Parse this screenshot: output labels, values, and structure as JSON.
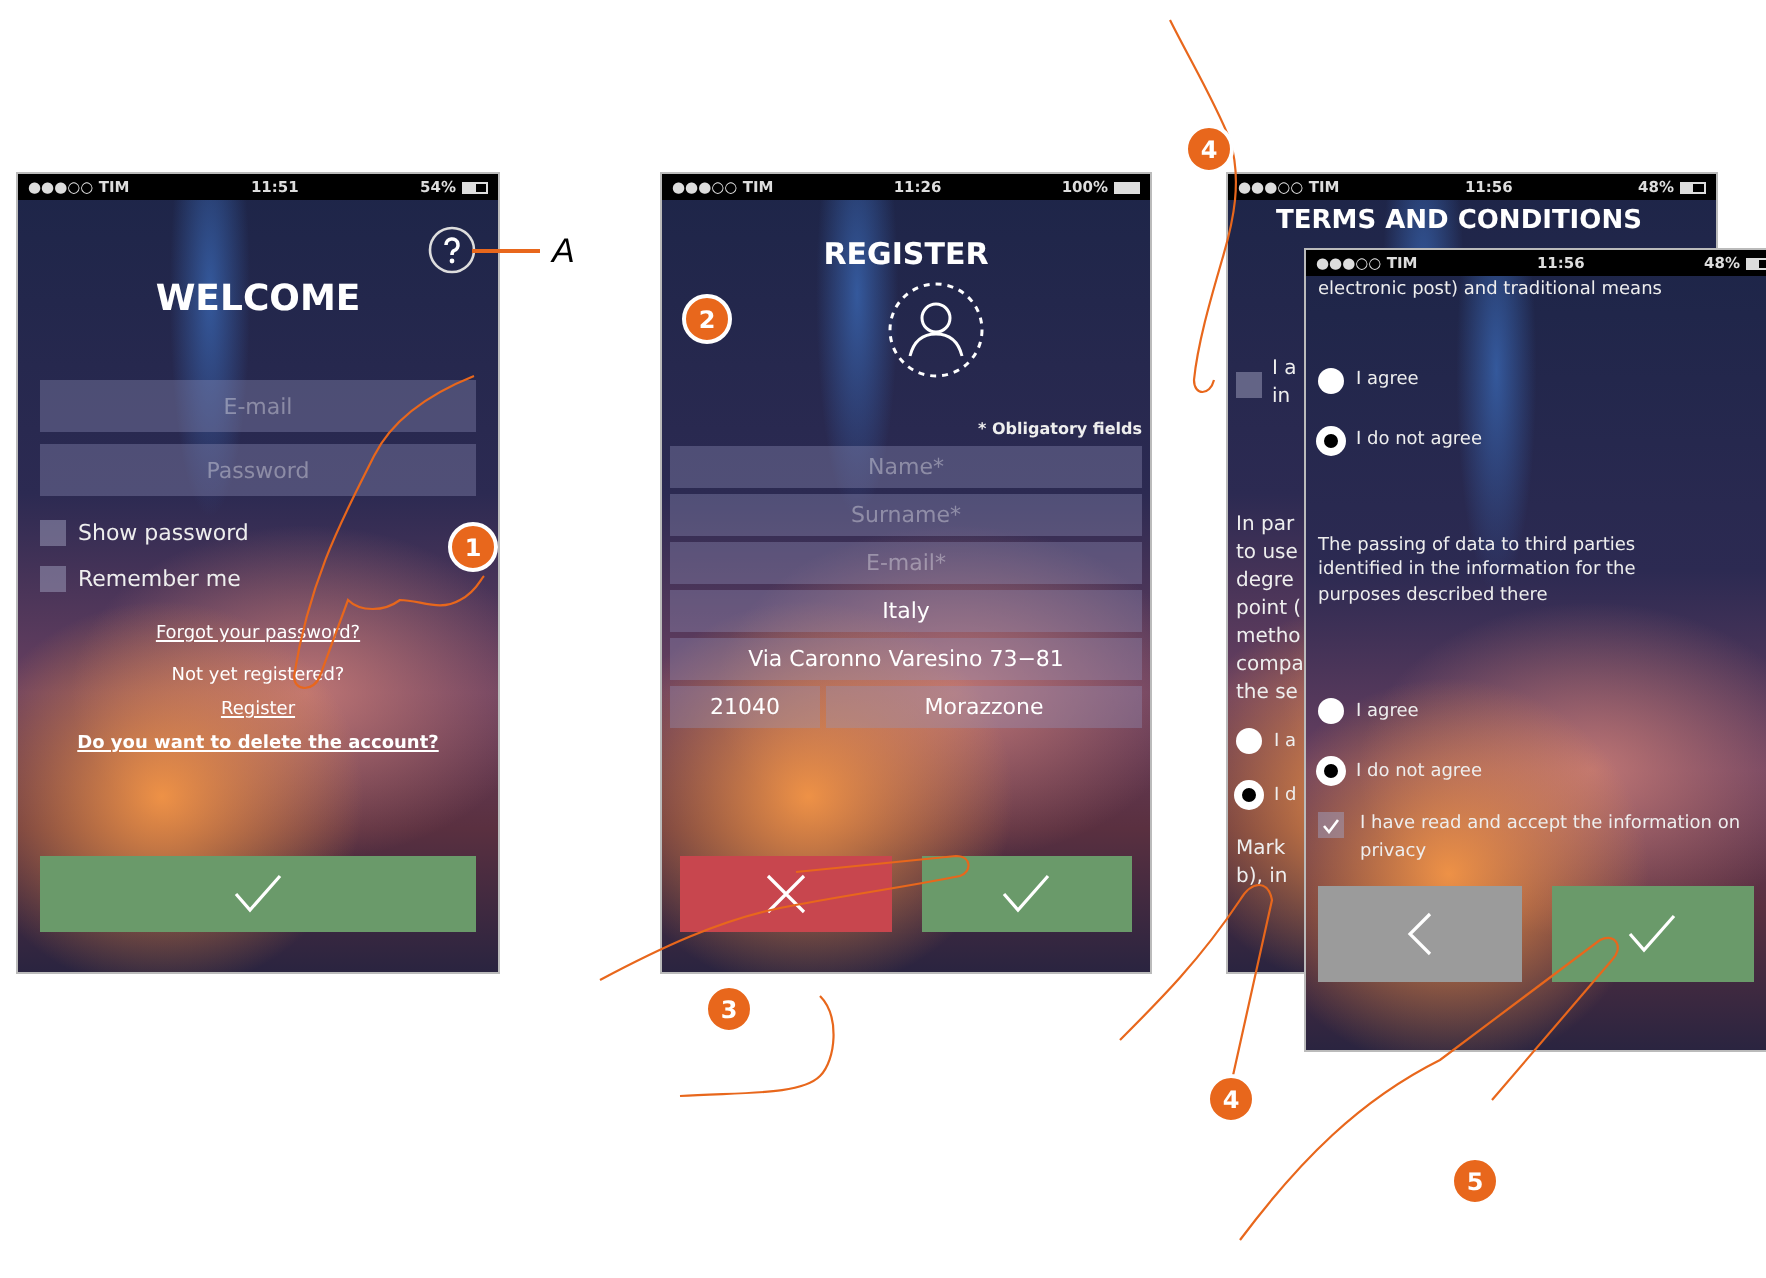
{
  "login": {
    "status": {
      "signal": "●●●○○ TIM",
      "time": "11:51",
      "battery": "54%"
    },
    "title": "WELCOME",
    "fields": [
      {
        "placeholder": "E-mail"
      },
      {
        "placeholder": "Password"
      }
    ],
    "checkboxes": [
      {
        "label": "Show password",
        "checked": false
      },
      {
        "label": "Remember me",
        "checked": false
      }
    ],
    "forgot_link": "Forgot your password?",
    "not_registered": "Not yet registered?",
    "register_link": "Register",
    "delete_link": "Do you want to delete the account?"
  },
  "register": {
    "status": {
      "signal": "●●●○○ TIM",
      "time": "11:26",
      "battery": "100%"
    },
    "title": "REGISTER",
    "note": "* Obligatory fields",
    "fields": [
      {
        "placeholder": "Name*"
      },
      {
        "placeholder": "Surname*"
      },
      {
        "placeholder": "E-mail*"
      },
      {
        "value": "Italy"
      },
      {
        "value": "Via Caronno Varesino 73−81"
      }
    ],
    "postcode": "21040",
    "city": "Morazzone"
  },
  "terms_back": {
    "status": {
      "signal": "●●●○○ TIM",
      "time": "11:56",
      "battery": "48%"
    },
    "title": "TERMS AND CONDITIONS",
    "check_lines": [
      "I a",
      "in"
    ],
    "checked": false,
    "paragraph_lines": [
      "In par",
      "to use",
      "degre",
      "point (",
      "metho",
      "compa",
      "the se"
    ],
    "radios": [
      {
        "label": "I a",
        "selected": false
      },
      {
        "label": "I d",
        "selected": true
      }
    ],
    "tail_lines": [
      "Mark",
      "b), in"
    ]
  },
  "terms_front": {
    "status": {
      "signal": "●●●○○ TIM",
      "time": "11:56",
      "battery": "48%"
    },
    "intro": "electronic post) and traditional means",
    "radios_1": [
      {
        "label": "I agree",
        "selected": false
      },
      {
        "label": "I do not agree",
        "selected": true
      }
    ],
    "paragraph": "The passing of data to third parties identified in the information for the purposes described there",
    "radios_2": [
      {
        "label": "I agree",
        "selected": false
      },
      {
        "label": "I do not agree",
        "selected": true
      }
    ],
    "privacy": {
      "label": "I have read and accept the information on privacy",
      "checked": true
    }
  },
  "callouts": [
    "1",
    "2",
    "3",
    "4",
    "4",
    "5"
  ],
  "annotation": "A"
}
